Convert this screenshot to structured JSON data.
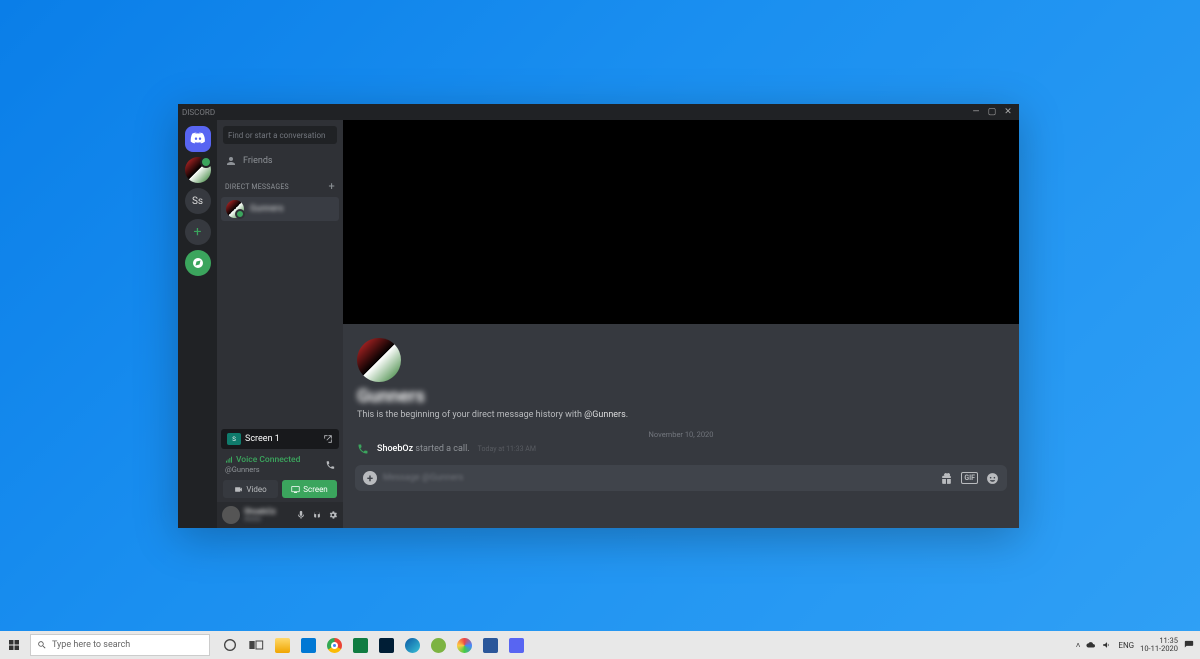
{
  "titlebar": {
    "title": "DISCORD"
  },
  "rail": {
    "ss_label": "Ss",
    "add_label": "+"
  },
  "sidebar": {
    "search_placeholder": "Find or start a conversation",
    "friends_label": "Friends",
    "dm_header": "DIRECT MESSAGES",
    "dm_add": "+",
    "dm_items": [
      {
        "name": "Gunners"
      }
    ],
    "screen_share_label": "Screen 1",
    "voice_status": "Voice Connected",
    "voice_channel": "@Gunners",
    "video_btn": "Video",
    "screen_btn": "Screen",
    "user": {
      "name": "ShoebOz",
      "tag": "#0000"
    }
  },
  "chat": {
    "big_name": "Gunners",
    "start_text_prefix": "This is the beginning of your direct message history with ",
    "start_text_mention": "@Gunners",
    "start_text_suffix": ".",
    "date_divider": "November 10, 2020",
    "call_msg": {
      "author": "ShoebOz",
      "action": " started a call.",
      "ts": "Today at 11:33 AM"
    },
    "compose_placeholder": "Message @Gunners",
    "gif_label": "GIF"
  },
  "taskbar": {
    "search_placeholder": "Type here to search",
    "lang": "ENG",
    "time": "11:35",
    "date": "10-11-2020"
  }
}
